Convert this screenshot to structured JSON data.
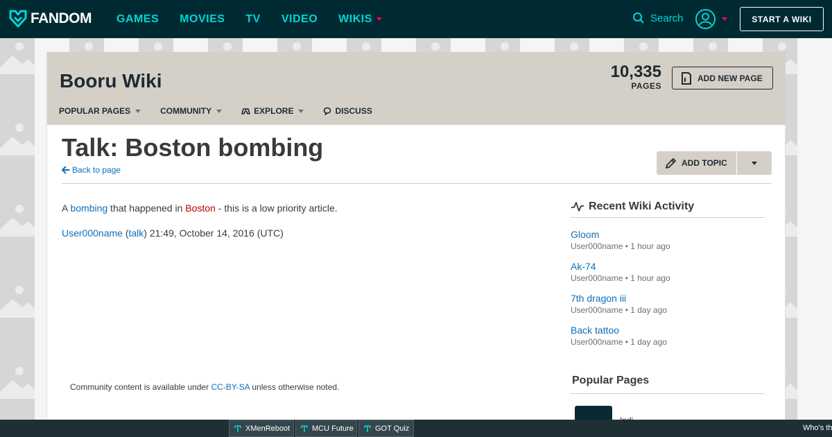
{
  "global_nav": {
    "logo_text": "FANDOM",
    "links": [
      {
        "label": "GAMES",
        "has_caret": false
      },
      {
        "label": "MOVIES",
        "has_caret": false
      },
      {
        "label": "TV",
        "has_caret": false
      },
      {
        "label": "VIDEO",
        "has_caret": false
      },
      {
        "label": "WIKIS",
        "has_caret": true
      }
    ],
    "search_label": "Search",
    "start_wiki_label": "START A WIKI"
  },
  "wiki_header": {
    "wiki_name": "Booru Wiki",
    "page_count": "10,335",
    "page_count_label": "PAGES",
    "add_new_page_label": "ADD NEW PAGE",
    "tabs": [
      {
        "label": "POPULAR PAGES"
      },
      {
        "label": "COMMUNITY"
      },
      {
        "label": "EXPLORE"
      },
      {
        "label": "DISCUSS"
      }
    ]
  },
  "page": {
    "title": "Talk: Boston bombing",
    "back_link": "Back to page",
    "add_topic_label": "ADD TOPIC",
    "paragraph1": {
      "prefix": "A ",
      "link1": "bombing",
      "middle": " that happened in ",
      "link2": "Boston",
      "suffix": " - this is a low priority article."
    },
    "signature": {
      "user": "User000name",
      "open_paren": " (",
      "talk": "talk",
      "rest": ") 21:49, October 14, 2016 (UTC)"
    },
    "footer": {
      "prefix": "Community content is available under ",
      "license": "CC-BY-SA",
      "suffix": " unless otherwise noted."
    }
  },
  "rail": {
    "recent_title": "Recent Wiki Activity",
    "activity": [
      {
        "title": "Gloom",
        "meta": "User000name • 1 hour ago"
      },
      {
        "title": "Ak-74",
        "meta": "User000name • 1 hour ago"
      },
      {
        "title": "7th dragon iii",
        "meta": "User000name • 1 day ago"
      },
      {
        "title": "Back tattoo",
        "meta": "User000name • 1 day ago"
      }
    ],
    "popular_title": "Popular Pages",
    "popular_partial": "Indi..."
  },
  "bottom_bar": {
    "items": [
      "XMenReboot",
      "MCU Future",
      "GOT Quiz"
    ],
    "right_text": "Who's th"
  },
  "colors": {
    "nav_bg": "#002a32",
    "nav_link": "#00d6d6",
    "accent_red": "#fa005a",
    "header_bg": "#d4d0c8",
    "link_blue": "#0e6fb8",
    "link_red": "#ba0000"
  }
}
